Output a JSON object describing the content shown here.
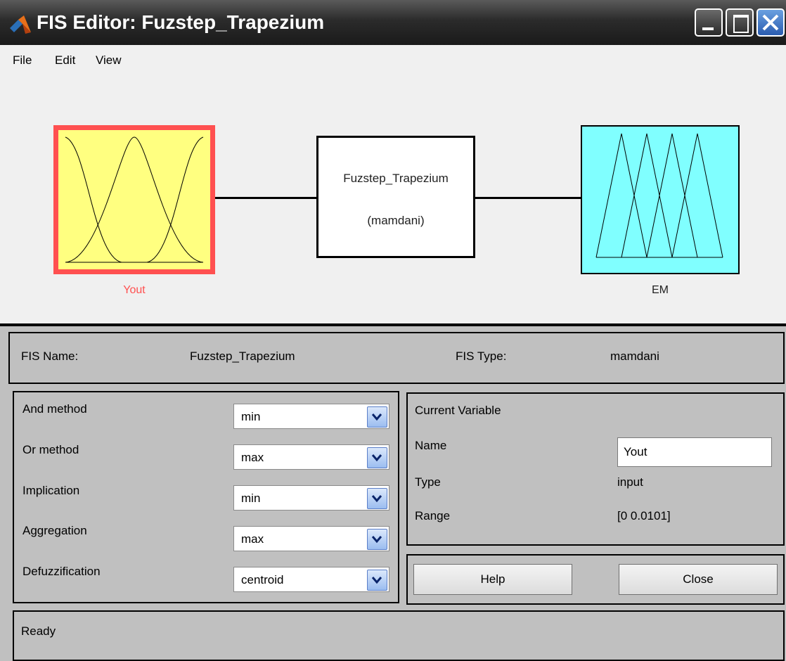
{
  "window": {
    "title": "FIS Editor: Fuzstep_Trapezium"
  },
  "menu": {
    "items": [
      "File",
      "Edit",
      "View"
    ]
  },
  "diagram": {
    "input": {
      "label": "Yout",
      "fill": "#ffff80",
      "border": "#ff5050"
    },
    "system": {
      "name": "Fuzstep_Trapezium",
      "type": "(mamdani)"
    },
    "output": {
      "label": "EM",
      "fill": "#80ffff"
    }
  },
  "fis": {
    "name_label": "FIS Name:",
    "name": "Fuzstep_Trapezium",
    "type_label": "FIS Type:",
    "type": "mamdani"
  },
  "methods": [
    {
      "label": "And method",
      "value": "min"
    },
    {
      "label": "Or method",
      "value": "max"
    },
    {
      "label": "Implication",
      "value": "min"
    },
    {
      "label": "Aggregation",
      "value": "max"
    },
    {
      "label": "Defuzzification",
      "value": "centroid"
    }
  ],
  "current": {
    "heading": "Current Variable",
    "name_label": "Name",
    "name": "Yout",
    "type_label": "Type",
    "type": "input",
    "range_label": "Range",
    "range": "[0 0.0101]"
  },
  "buttons": {
    "help": "Help",
    "close": "Close"
  },
  "status": "Ready"
}
